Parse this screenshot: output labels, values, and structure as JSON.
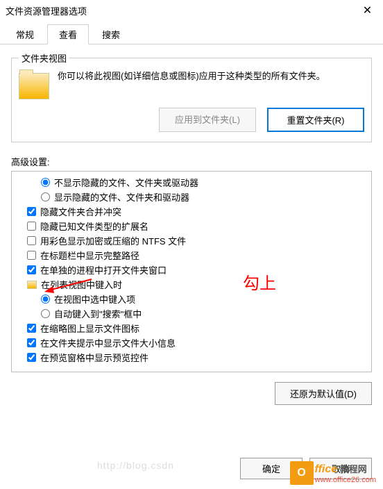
{
  "window": {
    "title": "文件资源管理器选项",
    "close": "✕"
  },
  "tabs": {
    "general": "常规",
    "view": "查看",
    "search": "搜索"
  },
  "folderViews": {
    "legend": "文件夹视图",
    "desc": "你可以将此视图(如详细信息或图标)应用于这种类型的所有文件夹。",
    "applyBtn": "应用到文件夹(L)",
    "resetBtn": "重置文件夹(R)"
  },
  "advanced": {
    "label": "高级设置:",
    "items": {
      "r1": "不显示隐藏的文件、文件夹或驱动器",
      "r2": "显示隐藏的文件、文件夹和驱动器",
      "c1": "隐藏文件夹合并冲突",
      "c2": "隐藏已知文件类型的扩展名",
      "c3": "用彩色显示加密或压缩的 NTFS 文件",
      "c4": "在标题栏中显示完整路径",
      "c5": "在单独的进程中打开文件夹窗口",
      "g1": "在列表视图中键入时",
      "r3": "在视图中选中键入项",
      "r4": "自动键入到\"搜索\"框中",
      "c6": "在缩略图上显示文件图标",
      "c7": "在文件夹提示中显示文件大小信息",
      "c8": "在预览窗格中显示预览控件"
    },
    "restoreBtn": "还原为默认值(D)"
  },
  "annotation": "勾上",
  "watermark": "http://blog.csdn",
  "footer": {
    "ok": "确定",
    "cancel": "取消"
  },
  "logo": {
    "o": "O",
    "brand": "ffice",
    "suffix": "教程网",
    "url": "www.office26.com"
  }
}
